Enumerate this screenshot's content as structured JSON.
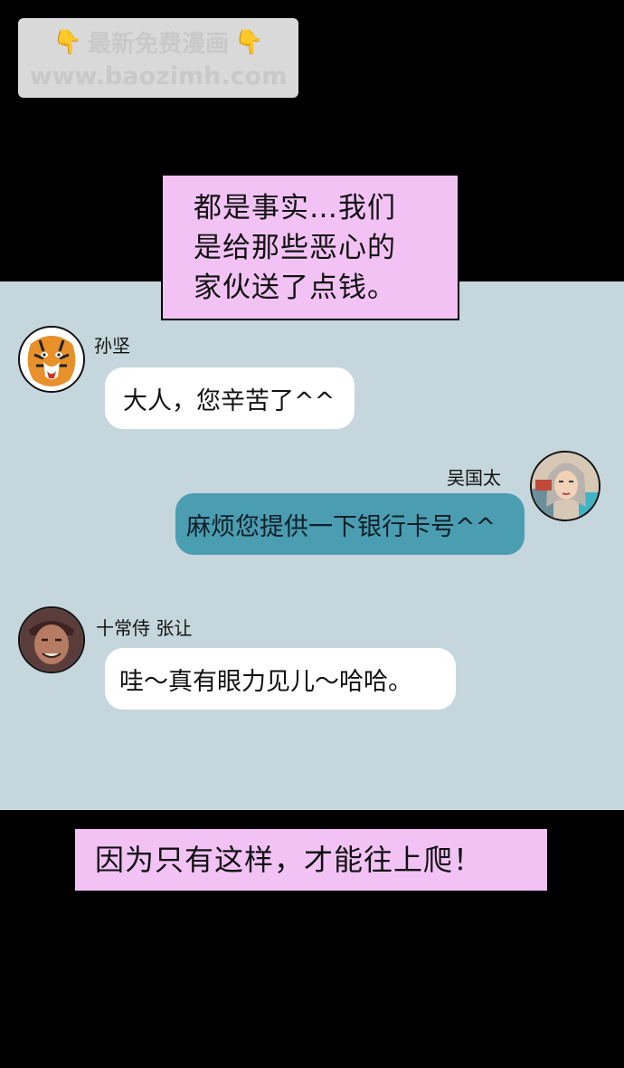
{
  "watermark": {
    "line1": "最新免费漫画",
    "line2": "www.baozimh.com",
    "hand_icon": "👇"
  },
  "captions": {
    "top_lines": [
      "都是事实…我们",
      "是给那些恶心的",
      "家伙送了点钱。"
    ],
    "bottom": "因为只有这样，才能往上爬！"
  },
  "chat": {
    "messages": [
      {
        "sender": "孙坚",
        "text": "大人，您辛苦了^^",
        "side": "left",
        "avatar": "tiger-icon"
      },
      {
        "sender": "吴国太",
        "text": "麻烦您提供一下银行卡号^^",
        "side": "right",
        "avatar": "woman-portrait"
      },
      {
        "sender": "十常侍 张让",
        "text": "哇～真有眼力见儿～哈哈。",
        "side": "left",
        "avatar": "man-portrait"
      }
    ]
  },
  "colors": {
    "background": "#000000",
    "chat_panel": "#c5d6dc",
    "caption_bg": "#f2c2f5",
    "bubble_white": "#ffffff",
    "bubble_blue": "#4b9db2"
  }
}
